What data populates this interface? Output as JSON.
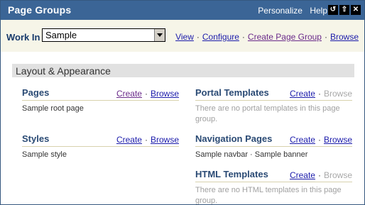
{
  "window": {
    "title": "Page Groups",
    "personalize": "Personalize",
    "help": "Help",
    "icons": [
      "refresh-icon",
      "collapse-icon",
      "close-icon"
    ]
  },
  "workin": {
    "label": "Work In",
    "selected": "Sample",
    "links": [
      "View",
      "Configure",
      "Create Page Group",
      "Browse"
    ]
  },
  "section": {
    "title": "Layout & Appearance"
  },
  "pages": {
    "title": "Pages",
    "create": "Create",
    "browse": "Browse",
    "text": "Sample root page"
  },
  "styles": {
    "title": "Styles",
    "create": "Create",
    "browse": "Browse",
    "text": "Sample style"
  },
  "portal": {
    "title": "Portal Templates",
    "create": "Create",
    "browse": "Browse",
    "text": "There are no portal templates in this page group."
  },
  "navigation": {
    "title": "Navigation Pages",
    "create": "Create",
    "browse": "Browse",
    "text": "Sample navbar · Sample banner"
  },
  "html": {
    "title": "HTML Templates",
    "create": "Create",
    "browse": "Browse",
    "text": "There are no HTML templates in this page group."
  },
  "colors": {
    "titlebar": "#3b6596",
    "panel": "#f6f5e8",
    "heading": "#2a4a74",
    "link": "#1c1cab"
  }
}
